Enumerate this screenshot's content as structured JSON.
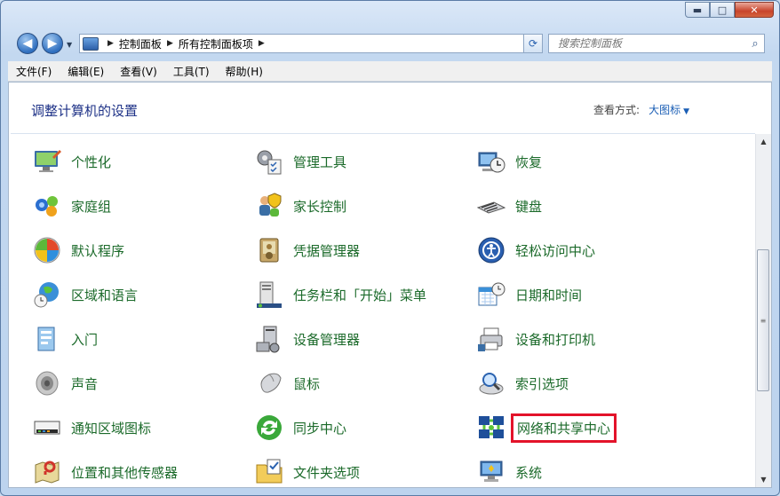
{
  "window": {
    "minimize": "▬",
    "maximize": "□",
    "close": "✕"
  },
  "address": {
    "crumbs": [
      "控制面板",
      "所有控制面板项"
    ]
  },
  "search": {
    "placeholder": "搜索控制面板"
  },
  "menu": [
    "文件(F)",
    "编辑(E)",
    "查看(V)",
    "工具(T)",
    "帮助(H)"
  ],
  "content": {
    "heading": "调整计算机的设置",
    "view_by_label": "查看方式:",
    "view_by_value": "大图标"
  },
  "items": {
    "col1": [
      "个性化",
      "家庭组",
      "默认程序",
      "区域和语言",
      "入门",
      "声音",
      "通知区域图标",
      "位置和其他传感器"
    ],
    "col2": [
      "管理工具",
      "家长控制",
      "凭据管理器",
      "任务栏和「开始」菜单",
      "设备管理器",
      "鼠标",
      "同步中心",
      "文件夹选项"
    ],
    "col3": [
      "恢复",
      "键盘",
      "轻松访问中心",
      "日期和时间",
      "设备和打印机",
      "索引选项",
      "网络和共享中心",
      "系统"
    ]
  },
  "highlighted_item": "网络和共享中心",
  "colors": {
    "link_green": "#1b6a2a",
    "heading_blue": "#1e3287",
    "highlight_red": "#e3132a"
  }
}
